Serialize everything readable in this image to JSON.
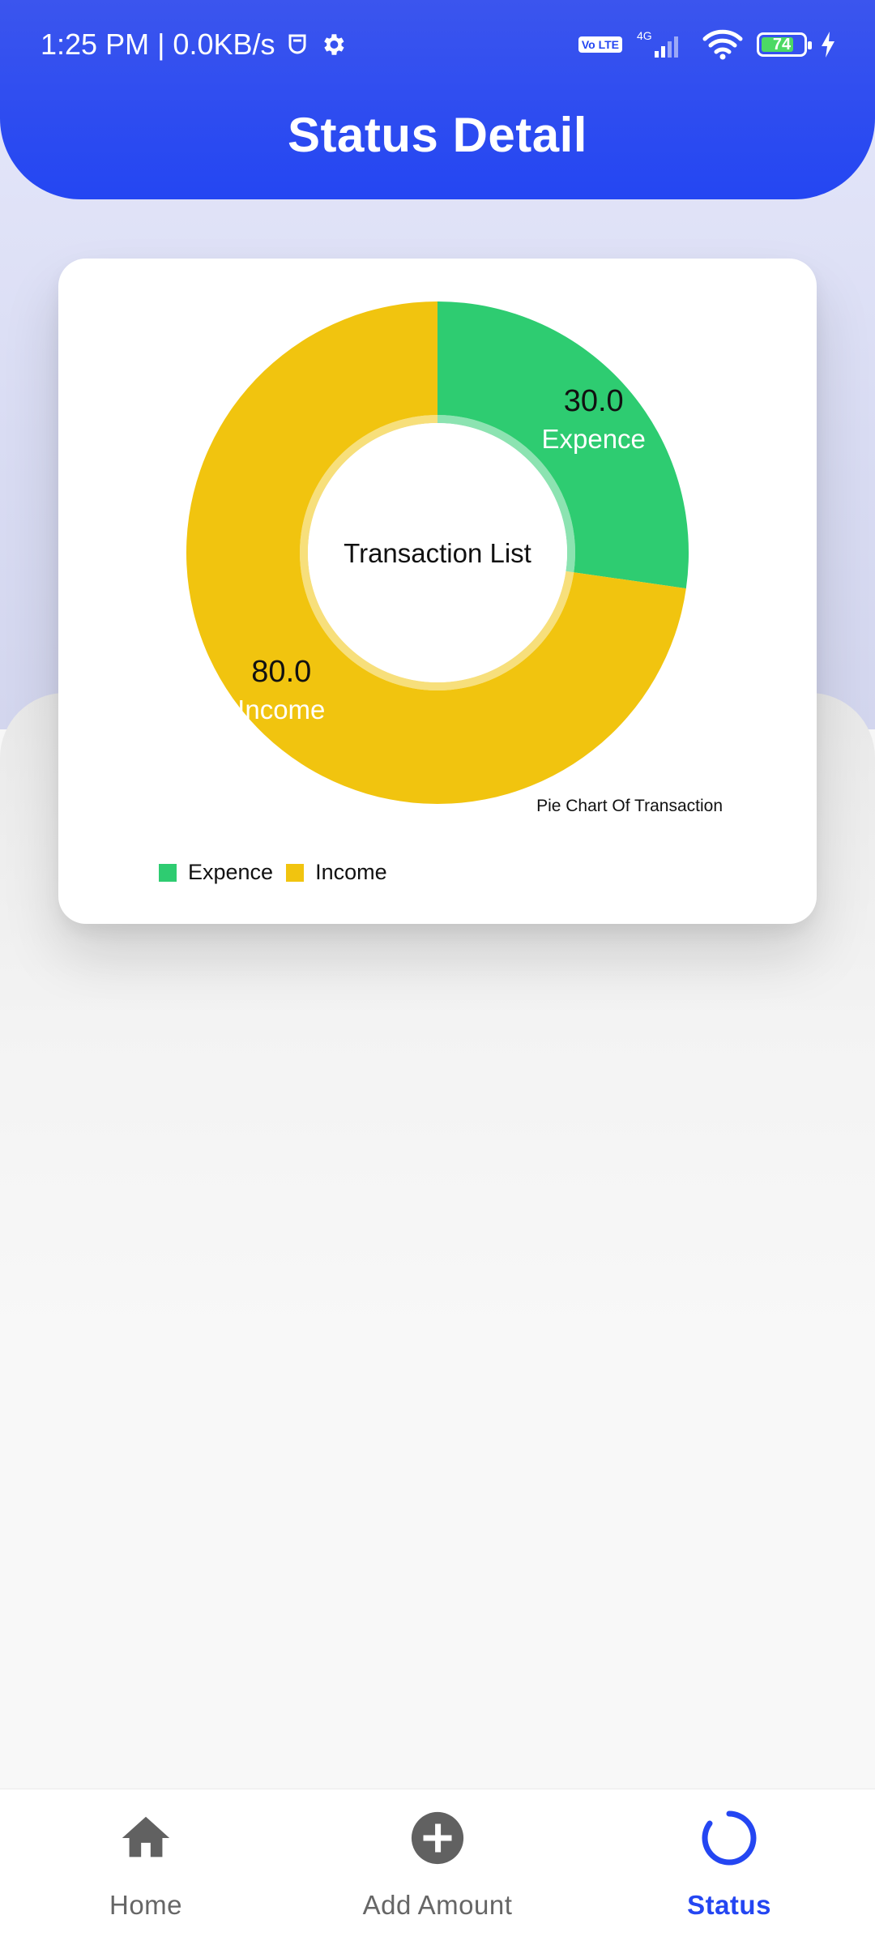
{
  "status_bar": {
    "time_speed": "1:25 PM | 0.0KB/s",
    "volte": "Vo LTE",
    "network": "4G",
    "battery": "74"
  },
  "header": {
    "title": "Status Detail"
  },
  "card": {
    "center_label": "Transaction List",
    "caption": "Pie Chart Of Transaction",
    "legend": [
      {
        "name": "Expence",
        "color": "#2ecc71"
      },
      {
        "name": "Income",
        "color": "#f1c40f"
      }
    ]
  },
  "chart_data": {
    "type": "pie",
    "variant": "donut",
    "title": "Pie Chart Of Transaction",
    "center_text": "Transaction List",
    "slices": [
      {
        "label": "Expence",
        "value": 30.0,
        "display": "30.0",
        "color": "#2ecc71"
      },
      {
        "label": "Income",
        "value": 80.0,
        "display": "80.0",
        "color": "#f1c40f"
      }
    ],
    "legend_position": "bottom-left"
  },
  "bottom_nav": {
    "items": [
      {
        "label": "Home",
        "icon": "home-icon",
        "active": false
      },
      {
        "label": "Add Amount",
        "icon": "add-circle-icon",
        "active": false
      },
      {
        "label": "Status",
        "icon": "status-ring-icon",
        "active": true
      }
    ]
  },
  "colors": {
    "primary": "#2446f2",
    "expense": "#2ecc71",
    "income": "#f1c40f",
    "nav_inactive": "#616161"
  }
}
